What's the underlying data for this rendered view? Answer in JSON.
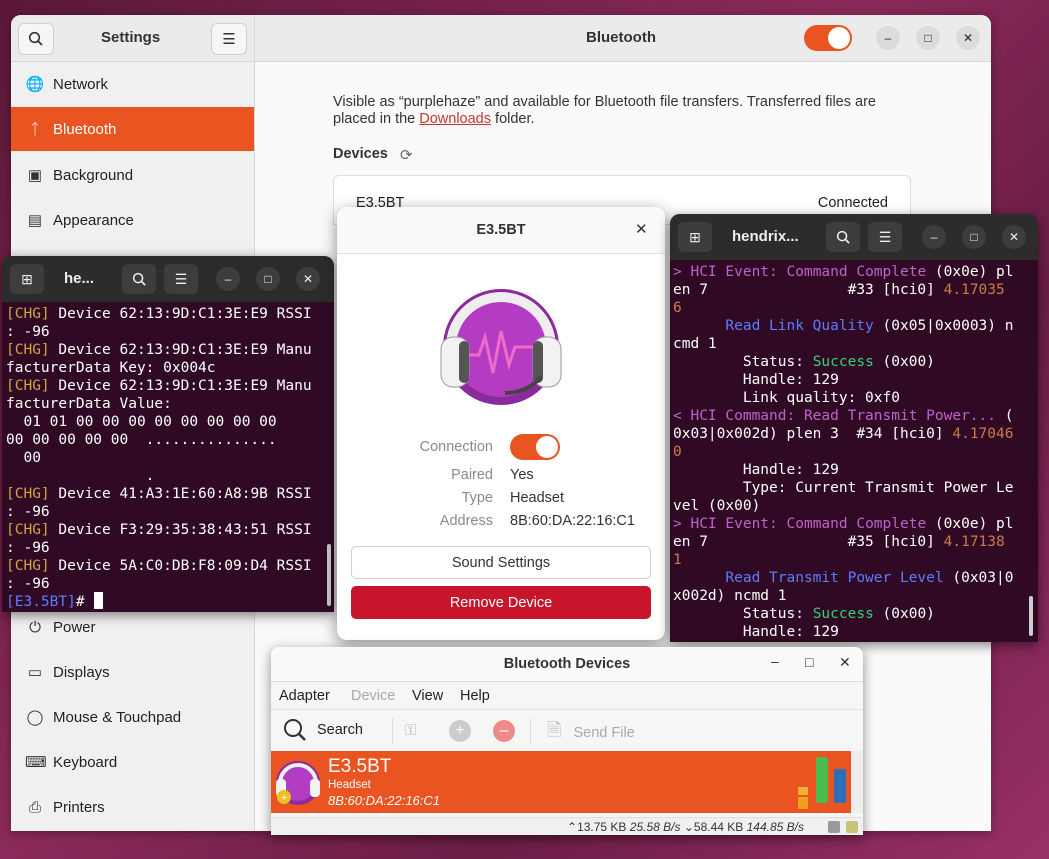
{
  "settings": {
    "sidebar_title": "Settings",
    "page_title": "Bluetooth",
    "sidebar_items": [
      {
        "label": "Network",
        "icon": "globe-icon"
      },
      {
        "label": "Bluetooth",
        "icon": "bluetooth-icon",
        "active": true
      },
      {
        "label": "Background",
        "icon": "monitor-icon"
      },
      {
        "label": "Appearance",
        "icon": "appearance-icon"
      },
      {
        "label": "Power",
        "icon": "power-icon"
      },
      {
        "label": "Displays",
        "icon": "displays-icon"
      },
      {
        "label": "Mouse & Touchpad",
        "icon": "mouse-icon"
      },
      {
        "label": "Keyboard",
        "icon": "keyboard-icon"
      },
      {
        "label": "Printers",
        "icon": "printer-icon"
      }
    ],
    "visible_text_1": "Visible as “purplehaze” and available for Bluetooth file transfers. Transferred files are",
    "visible_text_2_pre": "placed in the ",
    "visible_link": "Downloads",
    "visible_text_2_post": " folder.",
    "devices_heading": "Devices",
    "device_name": "E3.5BT",
    "device_status": "Connected",
    "bluetooth_enabled": true
  },
  "term_left": {
    "title": "he...",
    "lines": [
      [
        [
          "y",
          "[CHG]"
        ],
        [
          "w",
          " Device 62:13:9D:C1:3E:E9 RSSI"
        ]
      ],
      [
        [
          "w",
          ": -96"
        ]
      ],
      [
        [
          "y",
          "[CHG]"
        ],
        [
          "w",
          " Device 62:13:9D:C1:3E:E9 Manu"
        ]
      ],
      [
        [
          "w",
          "facturerData Key: 0x004c"
        ]
      ],
      [
        [
          "y",
          "[CHG]"
        ],
        [
          "w",
          " Device 62:13:9D:C1:3E:E9 Manu"
        ]
      ],
      [
        [
          "w",
          "facturerData Value:"
        ]
      ],
      [
        [
          "w",
          "  01 01 00 00 00 00 00 00 00 00"
        ]
      ],
      [
        [
          "w",
          "00 00 00 00 00  ..............."
        ]
      ],
      [
        [
          "w",
          "  00"
        ]
      ],
      [
        [
          "w",
          "                ."
        ]
      ],
      [
        [
          "y",
          "[CHG]"
        ],
        [
          "w",
          " Device 41:A3:1E:60:A8:9B RSSI"
        ]
      ],
      [
        [
          "w",
          ": -96"
        ]
      ],
      [
        [
          "y",
          "[CHG]"
        ],
        [
          "w",
          " Device F3:29:35:38:43:51 RSSI"
        ]
      ],
      [
        [
          "w",
          ": -96"
        ]
      ],
      [
        [
          "y",
          "[CHG]"
        ],
        [
          "w",
          " Device 5A:C0:DB:F8:09:D4 RSSI"
        ]
      ],
      [
        [
          "w",
          ": -96"
        ]
      ],
      [
        [
          "b",
          "[E3.5BT]"
        ],
        [
          "w",
          "# "
        ]
      ]
    ]
  },
  "dialog": {
    "title": "E3.5BT",
    "connection_label": "Connection",
    "connection_on": true,
    "paired_label": "Paired",
    "paired_value": "Yes",
    "type_label": "Type",
    "type_value": "Headset",
    "address_label": "Address",
    "address_value": "8B:60:DA:22:16:C1",
    "sound_settings": "Sound Settings",
    "remove_device": "Remove Device"
  },
  "term_right": {
    "title": "hendrix...",
    "lines": [
      [
        [
          "p",
          "> HCI Event: "
        ],
        [
          "p",
          "Command Complete"
        ],
        [
          "w",
          " (0x0e) pl"
        ]
      ],
      [
        [
          "w",
          "en 7                #33 [hci0] "
        ],
        [
          "o",
          "4.17035"
        ]
      ],
      [
        [
          "o",
          "6"
        ]
      ],
      [
        [
          "b",
          "      Read Link Quality"
        ],
        [
          "w",
          " (0x05|0x0003) n"
        ]
      ],
      [
        [
          "w",
          "cmd 1"
        ]
      ],
      [
        [
          "w",
          "        Status: "
        ],
        [
          "g",
          "Success"
        ],
        [
          "w",
          " (0x00)"
        ]
      ],
      [
        [
          "w",
          "        Handle: 129"
        ]
      ],
      [
        [
          "w",
          "        Link quality: 0xf0"
        ]
      ],
      [
        [
          "p",
          "< HCI Command: Read Transmit Power..."
        ],
        [
          "w",
          " ("
        ]
      ],
      [
        [
          "w",
          "0x03|0x002d) plen 3  #34 [hci0] "
        ],
        [
          "o",
          "4.17046"
        ]
      ],
      [
        [
          "o",
          "0"
        ]
      ],
      [
        [
          "w",
          "        Handle: 129"
        ]
      ],
      [
        [
          "w",
          "        Type: Current Transmit Power Le"
        ]
      ],
      [
        [
          "w",
          "vel (0x00)"
        ]
      ],
      [
        [
          "p",
          "> HCI Event: "
        ],
        [
          "p",
          "Command Complete"
        ],
        [
          "w",
          " (0x0e) pl"
        ]
      ],
      [
        [
          "w",
          "en 7                #35 [hci0] "
        ],
        [
          "o",
          "4.17138"
        ]
      ],
      [
        [
          "o",
          "1"
        ]
      ],
      [
        [
          "b",
          "      Read Transmit Power Level"
        ],
        [
          "w",
          " (0x03|0"
        ]
      ],
      [
        [
          "w",
          "x002d) ncmd 1"
        ]
      ],
      [
        [
          "w",
          "        Status: "
        ],
        [
          "g",
          "Success"
        ],
        [
          "w",
          " (0x00)"
        ]
      ],
      [
        [
          "w",
          "        Handle: 129"
        ]
      ]
    ]
  },
  "blueman": {
    "title": "Bluetooth Devices",
    "menu": [
      "Adapter",
      "Device",
      "View",
      "Help"
    ],
    "search_label": "Search",
    "send_file_label": "Send File",
    "device_name": "E3.5BT",
    "device_type": "Headset",
    "device_address": "8B:60:DA:22:16:C1",
    "status_up": "13.75 KB",
    "status_up_rate": "25.58 B/s",
    "status_down": "58.44 KB",
    "status_down_rate": "144.85 B/s",
    "accent": "#e95420"
  }
}
